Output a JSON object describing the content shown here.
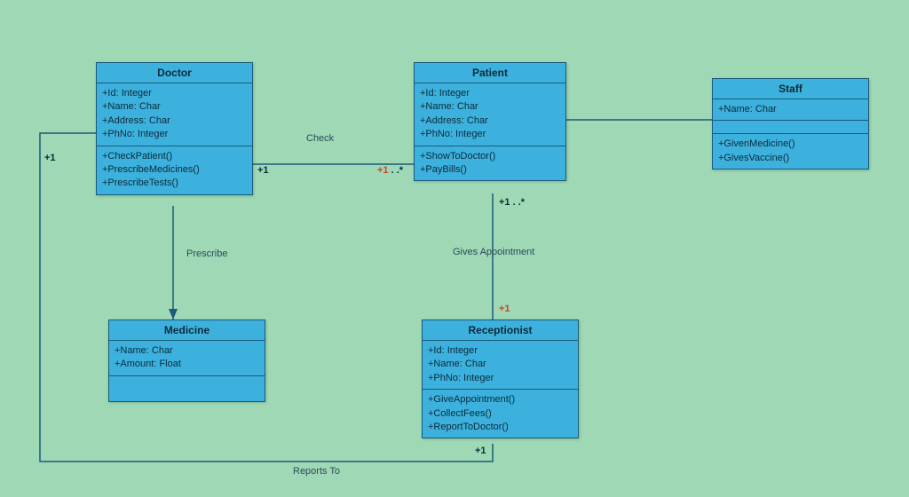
{
  "classes": {
    "doctor": {
      "title": "Doctor",
      "attrs": [
        "+Id: Integer",
        "+Name: Char",
        "+Address: Char",
        "+PhNo: Integer"
      ],
      "ops": [
        "+CheckPatient()",
        "+PrescribeMedicines()",
        "+PrescribeTests()"
      ]
    },
    "patient": {
      "title": "Patient",
      "attrs": [
        "+Id: Integer",
        "+Name: Char",
        "+Address: Char",
        "+PhNo: Integer"
      ],
      "ops": [
        "+ShowToDoctor()",
        "+PayBills()"
      ]
    },
    "staff": {
      "title": "Staff",
      "attrs": [
        "+Name: Char"
      ],
      "ops": [
        "+GivenMedicine()",
        "+GivesVaccine()"
      ]
    },
    "medicine": {
      "title": "Medicine",
      "attrs": [
        "+Name: Char",
        "+Amount: Float"
      ],
      "ops": []
    },
    "receptionist": {
      "title": "Receptionist",
      "attrs": [
        "+Id: Integer",
        "+Name: Char",
        "+PhNo: Integer"
      ],
      "ops": [
        "+GiveAppointment()",
        "+CollectFees()",
        "+ReportToDoctor()"
      ]
    }
  },
  "labels": {
    "check": "Check",
    "prescribe": "Prescribe",
    "gives_appointment": "Gives Appointment",
    "reports_to": "Reports To"
  },
  "mults": {
    "doctor_check": "+1",
    "patient_check": "+1 . .*",
    "patient_appt": "+1 . .*",
    "recep_appt": "+1",
    "recep_reports": "+1",
    "doctor_reports": "+1"
  }
}
